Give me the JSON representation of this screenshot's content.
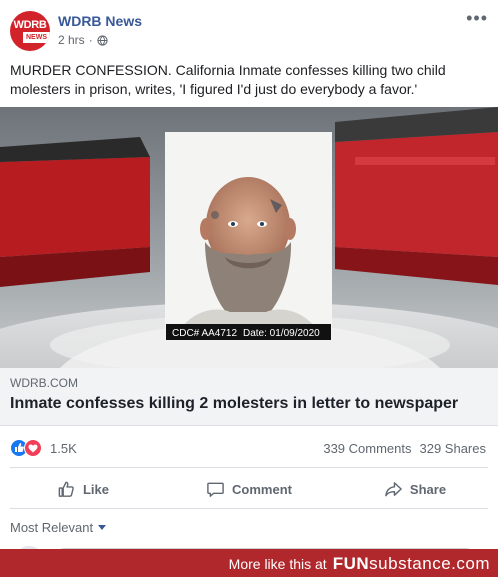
{
  "post": {
    "page_name": "WDRB News",
    "avatar_text_top": "WDRB",
    "avatar_text_bottom": "NEWS",
    "timestamp": "2 hrs",
    "separator": "·",
    "text": "MURDER CONFESSION. California Inmate confesses killing two child molesters in prison, writes, 'I figured I'd just do everybody a favor.'"
  },
  "link": {
    "image_caption_id": "CDC# AA4712",
    "image_caption_date": "Date: 01/09/2020",
    "domain": "WDRB.COM",
    "headline": "Inmate confesses killing 2 molesters in letter to newspaper"
  },
  "stats": {
    "reaction_count": "1.5K",
    "comments": "339 Comments",
    "shares": "329 Shares"
  },
  "actions": {
    "like": "Like",
    "comment": "Comment",
    "share": "Share"
  },
  "comments_section": {
    "sort_label": "Most Relevant"
  },
  "banner": {
    "text": "More like this at",
    "brand_bold": "FUN",
    "brand_rest": "substance.com"
  },
  "colors": {
    "facebook_blue": "#385898",
    "like_blue": "#1877f2",
    "love_red": "#f33e58",
    "banner_red": "#b1282c",
    "wdrb_red": "#d3232a"
  }
}
